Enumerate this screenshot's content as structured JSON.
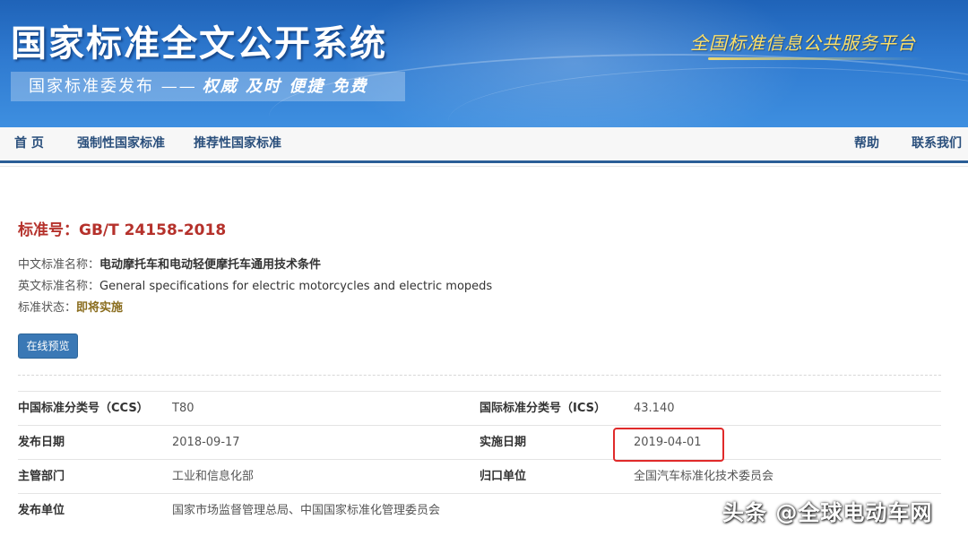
{
  "banner": {
    "title": "国家标准全文公开系统",
    "subtitle": "国家标准委发布 ——",
    "slogan": "权威 及时 便捷 免费",
    "right_tag": "全国标准信息公共服务平台"
  },
  "nav": {
    "home": "首 页",
    "mandatory": "强制性国家标准",
    "recommended": "推荐性国家标准",
    "help": "帮助",
    "contact": "联系我们"
  },
  "standard": {
    "number_label": "标准号：",
    "number": "GB/T 24158-2018",
    "cn_name_label": "中文标准名称：",
    "cn_name": "电动摩托车和电动轻便摩托车通用技术条件",
    "en_name_label": "英文标准名称：",
    "en_name": "General specifications for electric motorcycles and electric mopeds",
    "status_label": "标准状态：",
    "status": "即将实施",
    "preview_button": "在线预览"
  },
  "details": {
    "rows": [
      {
        "l1": "中国标准分类号（CCS）",
        "v1": "T80",
        "l2": "国际标准分类号（ICS）",
        "v2": "43.140"
      },
      {
        "l1": "发布日期",
        "v1": "2018-09-17",
        "l2": "实施日期",
        "v2": "2019-04-01"
      },
      {
        "l1": "主管部门",
        "v1": "工业和信息化部",
        "l2": "归口单位",
        "v2": "全国汽车标准化技术委员会"
      },
      {
        "l1": "发布单位",
        "v1": "国家市场监督管理总局、中国国家标准化管理委员会",
        "l2": "",
        "v2": ""
      }
    ]
  },
  "watermark": "头条 @全球电动车网",
  "colors": {
    "banner_blue": "#2f7ad0",
    "nav_border": "#2a5e97",
    "title_red": "#b5312b",
    "button_blue": "#3a78b5",
    "highlight_red": "#e02a2a",
    "status_gold": "#8a6d1e"
  }
}
